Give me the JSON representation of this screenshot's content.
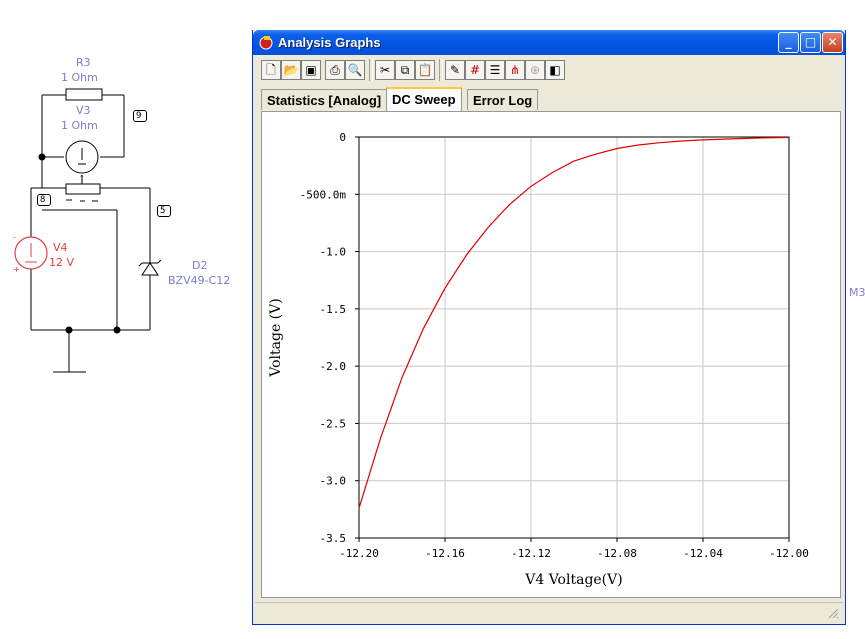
{
  "schematic": {
    "r3": {
      "name": "R3",
      "value": "1 Ohm"
    },
    "v3": {
      "name": "V3",
      "value": "1 Ohm"
    },
    "v4": {
      "name": "V4",
      "value": "12 V"
    },
    "d2": {
      "name": "D2",
      "value": "BZV49-C12"
    },
    "nodes": [
      "9",
      "8",
      "5"
    ],
    "side_label": "M3"
  },
  "window": {
    "title": "Analysis Graphs",
    "toolbar_icons": [
      "new-icon",
      "open-icon",
      "save-icon",
      "print-icon",
      "print-preview-icon",
      "cut-icon",
      "copy-icon",
      "paste-icon",
      "properties-icon",
      "grid-icon",
      "legend-icon",
      "cursor-icon",
      "zoom-icon",
      "overview-icon"
    ],
    "tabs": [
      {
        "label": "Statistics [Analog]",
        "active": false
      },
      {
        "label": "DC Sweep",
        "active": true
      },
      {
        "label": "Error Log",
        "active": false
      }
    ],
    "accent_color": "#0553e3"
  },
  "chart_data": {
    "type": "line",
    "title": "",
    "xlabel": "V4 Voltage(V)",
    "ylabel": "Voltage (V)",
    "xlim": [
      -12.2,
      -12.0
    ],
    "ylim": [
      -3.5,
      0
    ],
    "x_ticks": [
      "-12.20",
      "-12.16",
      "-12.12",
      "-12.08",
      "-12.04",
      "-12.00"
    ],
    "y_ticks": [
      "0",
      "-500.0m",
      "-1.0",
      "-1.5",
      "-2.0",
      "-2.5",
      "-3.0",
      "-3.5"
    ],
    "grid": true,
    "series": [
      {
        "color": "#e00000",
        "x": [
          -12.2,
          -12.19,
          -12.18,
          -12.17,
          -12.16,
          -12.15,
          -12.14,
          -12.13,
          -12.12,
          -12.11,
          -12.1,
          -12.09,
          -12.08,
          -12.07,
          -12.06,
          -12.05,
          -12.04,
          -12.03,
          -12.02,
          -12.01,
          -12.0
        ],
        "y": [
          -3.24,
          -2.63,
          -2.1,
          -1.67,
          -1.32,
          -1.03,
          -0.79,
          -0.59,
          -0.43,
          -0.31,
          -0.21,
          -0.15,
          -0.1,
          -0.07,
          -0.05,
          -0.035,
          -0.025,
          -0.018,
          -0.012,
          -0.007,
          -0.004
        ]
      }
    ]
  }
}
